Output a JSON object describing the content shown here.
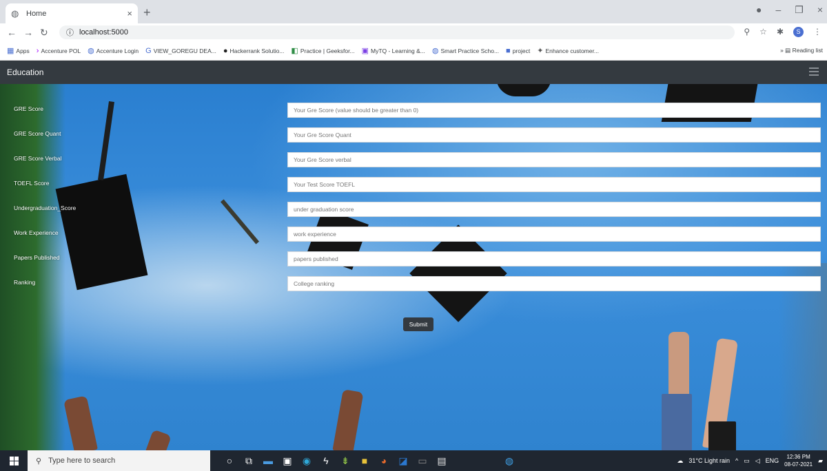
{
  "browser": {
    "tab_title": "Home",
    "url": "localhost:5000",
    "bookmarks": [
      "Apps",
      "Accenture POL",
      "Accenture Login",
      "VIEW_GOREGU DEA...",
      "Hackerrank Solutio...",
      "Practice | Geeksfor...",
      "MyTQ - Learning &...",
      "Smart Practice Scho...",
      "project",
      "Enhance customer..."
    ],
    "reading_list": "Reading list"
  },
  "navbar": {
    "brand": "Education"
  },
  "form": {
    "labels": [
      "GRE Score",
      "GRE Score Quant",
      "GRE Score Verbal",
      "TOEFL Score",
      "Undergraduation_Score",
      "Work Experience",
      "Papers Published",
      "Ranking"
    ],
    "placeholders": [
      "Your Gre Score (value should be greater than 0)",
      "Your Gre Score Quant",
      "Your Gre Score verbal",
      "Your Test Score TOEFL",
      "under graduation score",
      "work experience",
      "papers published",
      "College ranking"
    ],
    "submit_label": "Submit"
  },
  "taskbar": {
    "search_placeholder": "Type here to search",
    "weather": "31°C  Light rain",
    "language": "ENG",
    "time": "12:36 PM",
    "date": "08-07-2021"
  }
}
